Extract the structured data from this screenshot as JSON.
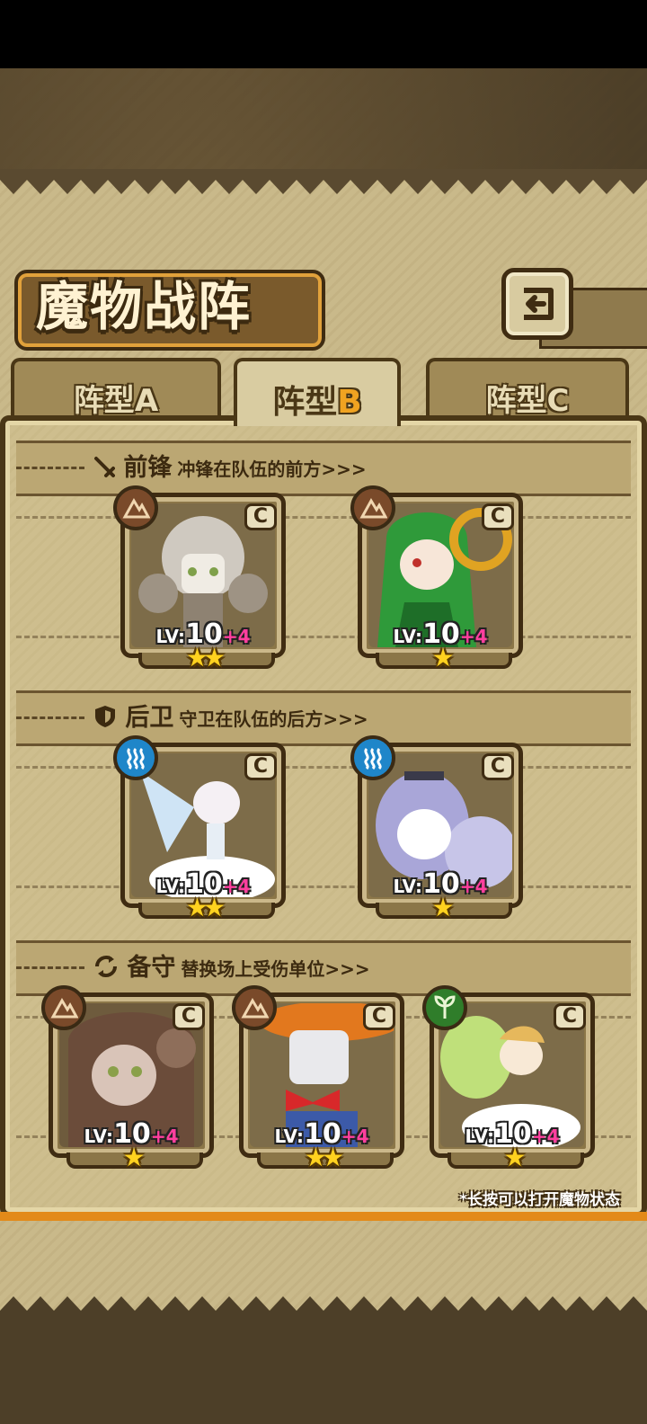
{
  "title": "魔物战阵",
  "tabs": [
    {
      "text": "阵型",
      "letter": "A"
    },
    {
      "text": "阵型",
      "letter": "B"
    },
    {
      "text": "阵型",
      "letter": "C"
    }
  ],
  "active_tab": 1,
  "sections": [
    {
      "title": "前锋",
      "desc": "冲锋在队伍的前方>>>",
      "icon": "sword-icon"
    },
    {
      "title": "后卫",
      "desc": "守卫在队伍的后方>>>",
      "icon": "shield-icon"
    },
    {
      "title": "备守",
      "desc": "替换场上受伤单位>>>",
      "icon": "swap-icon"
    }
  ],
  "cards": [
    {
      "element": "earth-icon",
      "rarity": "C",
      "lv_prefix": "LV:",
      "level": "10",
      "bonus": "+4",
      "stars": "★★",
      "art": "rock-golem"
    },
    {
      "element": "earth-icon",
      "rarity": "C",
      "lv_prefix": "LV:",
      "level": "10",
      "bonus": "+4",
      "stars": "★",
      "art": "leaf-girl"
    },
    {
      "element": "water-icon",
      "rarity": "C",
      "lv_prefix": "LV:",
      "level": "10",
      "bonus": "+4",
      "stars": "★★",
      "art": "flower-fairy"
    },
    {
      "element": "water-icon",
      "rarity": "C",
      "lv_prefix": "LV:",
      "level": "10",
      "bonus": "+4",
      "stars": "★",
      "art": "feather-girl"
    },
    {
      "element": "earth-icon",
      "rarity": "C",
      "lv_prefix": "LV:",
      "level": "10",
      "bonus": "+4",
      "stars": "★",
      "art": "mud-girl"
    },
    {
      "element": "earth-icon",
      "rarity": "C",
      "lv_prefix": "LV:",
      "level": "10",
      "bonus": "+4",
      "stars": "★★",
      "art": "scarecrow"
    },
    {
      "element": "nature-icon",
      "rarity": "C",
      "lv_prefix": "LV:",
      "level": "10",
      "bonus": "+4",
      "stars": "★",
      "art": "leaf-sprite"
    }
  ],
  "hint": "*长按可以打开魔物状态",
  "colors": {
    "earth": "#7a4a2a",
    "water": "#1f86c9",
    "nature": "#2f7d2a",
    "accent": "#e38a19",
    "bonus": "#ff3f9e"
  }
}
